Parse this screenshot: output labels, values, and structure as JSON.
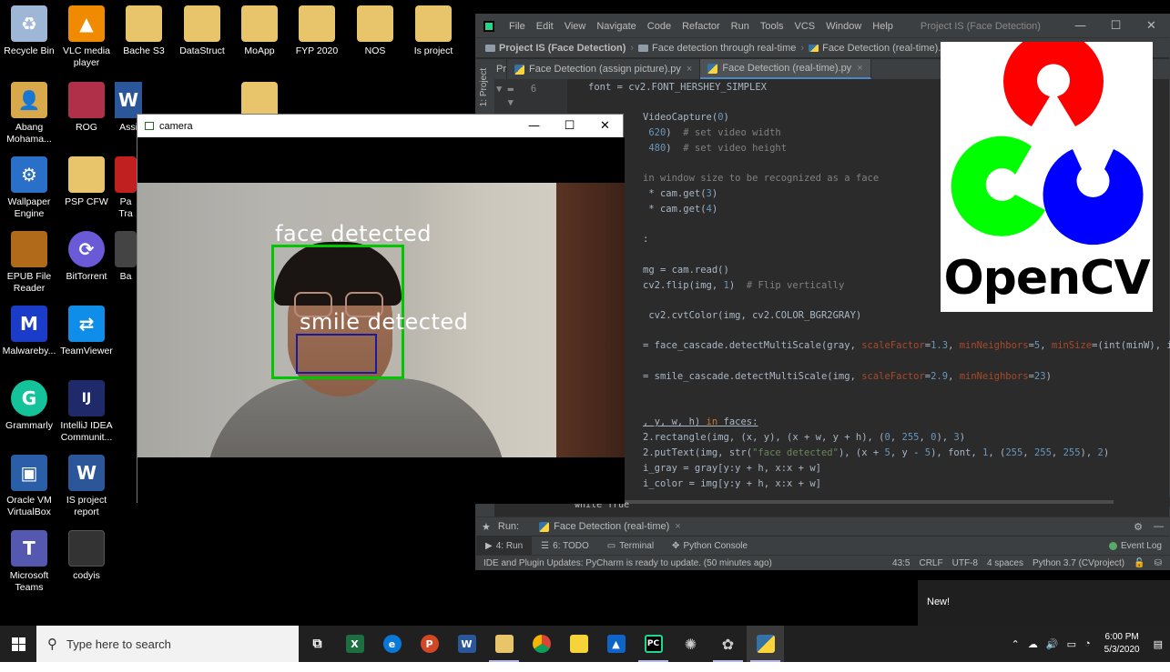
{
  "desktop": {
    "icons": [
      {
        "label": "Recycle Bin",
        "icon": "recycle-bin-icon",
        "color": "#9fb7d6",
        "glyph": "♻"
      },
      {
        "label": "VLC media player",
        "icon": "vlc-icon",
        "color": "#f08a00",
        "glyph": "▲"
      },
      {
        "label": "Bache S3",
        "icon": "folder-icon",
        "color": "#e8c46a",
        "glyph": ""
      },
      {
        "label": "DataStruct",
        "icon": "folder-icon",
        "color": "#e8c46a",
        "glyph": ""
      },
      {
        "label": "MoApp",
        "icon": "folder-icon",
        "color": "#e8c46a",
        "glyph": ""
      },
      {
        "label": "FYP 2020",
        "icon": "folder-icon",
        "color": "#e8c46a",
        "glyph": ""
      },
      {
        "label": "NOS",
        "icon": "folder-icon",
        "color": "#e8c46a",
        "glyph": ""
      },
      {
        "label": "Is project",
        "icon": "folder-icon",
        "color": "#e8c46a",
        "glyph": ""
      },
      {
        "label": "Abang Mohama...",
        "icon": "user-folder-icon",
        "color": "#d8a94a",
        "glyph": "👤"
      },
      {
        "label": "ROG",
        "icon": "rog-folder-icon",
        "color": "#b0304a",
        "glyph": ""
      },
      {
        "label": "Assi",
        "icon": "word-icon",
        "color": "#2b579a",
        "glyph": "W"
      },
      {
        "label": "Wallpaper Engine",
        "icon": "wallpaper-engine-icon",
        "color": "#2a70c8",
        "glyph": "⚙"
      },
      {
        "label": "PSP CFW",
        "icon": "folder-icon",
        "color": "#e8c46a",
        "glyph": ""
      },
      {
        "label": "Pa Tra",
        "icon": "app-icon",
        "color": "#c02020",
        "glyph": ""
      },
      {
        "label": "EPUB File Reader",
        "icon": "epub-icon",
        "color": "#b06a1a",
        "glyph": ""
      },
      {
        "label": "BitTorrent",
        "icon": "bittorrent-icon",
        "color": "#6a5ad8",
        "glyph": "⟳"
      },
      {
        "label": "Ba",
        "icon": "app-icon",
        "color": "#444",
        "glyph": ""
      },
      {
        "label": "Malwareby...",
        "icon": "malwarebytes-icon",
        "color": "#1a3cc8",
        "glyph": "M"
      },
      {
        "label": "TeamViewer",
        "icon": "teamviewer-icon",
        "color": "#0e8ee9",
        "glyph": "⇄"
      },
      {
        "label": "Grammarly",
        "icon": "grammarly-icon",
        "color": "#15c39a",
        "glyph": "G"
      },
      {
        "label": "IntelliJ IDEA Communit...",
        "icon": "intellij-icon",
        "color": "#1f2a6a",
        "glyph": "IJ"
      },
      {
        "label": "Oracle VM VirtualBox",
        "icon": "virtualbox-icon",
        "color": "#2a5fa8",
        "glyph": "▣"
      },
      {
        "label": "IS project report",
        "icon": "word-doc-icon",
        "color": "#2b579a",
        "glyph": "W"
      },
      {
        "label": "Microsoft Teams",
        "icon": "teams-icon",
        "color": "#5558af",
        "glyph": "T"
      },
      {
        "label": "codyis",
        "icon": "image-file-icon",
        "color": "#333",
        "glyph": ""
      }
    ]
  },
  "camera": {
    "title": "camera",
    "face_label": "face detected",
    "smile_label": "smile detected"
  },
  "ide": {
    "menu": [
      "File",
      "Edit",
      "View",
      "Navigate",
      "Code",
      "Refactor",
      "Run",
      "Tools",
      "VCS",
      "Window",
      "Help"
    ],
    "project_title": "Project IS (Face Detection)",
    "breadcrumb": [
      "Project IS (Face Detection)",
      "Face detection through real-time",
      "Face Detection (real-time).py"
    ],
    "tabs": [
      {
        "label": "Face Detection (assign picture).py"
      },
      {
        "label": "Face Detection (real-time).py"
      }
    ],
    "side_label": "1: Project",
    "code_crumb": "while True",
    "run_label": "Run:",
    "run_tab": "Face Detection (real-time)",
    "toolwindows": [
      "4: Run",
      "6: TODO",
      "Terminal",
      "Python Console"
    ],
    "event_log": "Event Log",
    "status_msg": "IDE and Plugin Updates: PyCharm is ready to update. (50 minutes ago)",
    "status_info": [
      "43:5",
      "CRLF",
      "UTF-8",
      "4 spaces",
      "Python 3.7 (CVproject)"
    ]
  },
  "logo": {
    "text": "OpenCV",
    "colors": {
      "red": "#ff0000",
      "green": "#00ff00",
      "blue": "#0000ff"
    }
  },
  "notification": {
    "text": "New!"
  },
  "taskbar": {
    "search_placeholder": "Type here to search",
    "time": "6:00 PM",
    "date": "5/3/2020"
  }
}
